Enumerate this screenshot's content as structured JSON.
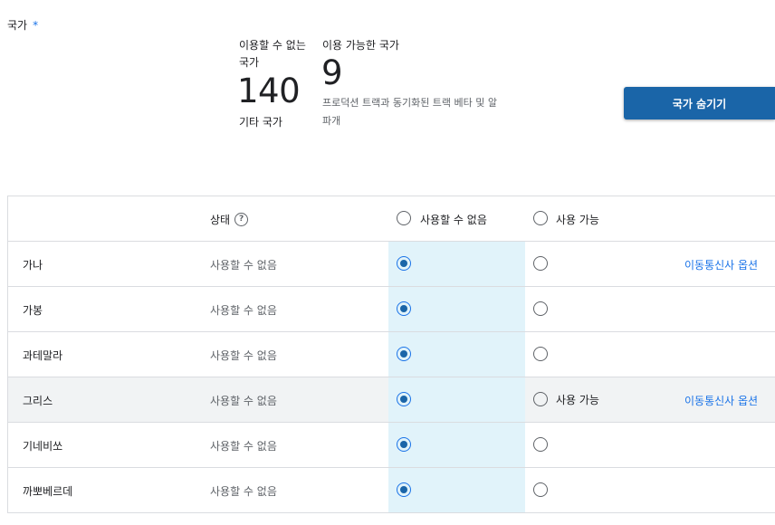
{
  "field": {
    "label": "국가",
    "required_mark": "*"
  },
  "stats": {
    "unavailable": {
      "label": "이용할 수 없는 국가",
      "count": "140",
      "sub": "기타 국가"
    },
    "available": {
      "label": "이용 가능한 국가",
      "count": "9",
      "sub": "프로덕션 트랙과 동기화된 트랙 베타 및 알파개"
    }
  },
  "hide_button": {
    "label": "국가 숨기기"
  },
  "table": {
    "header": {
      "status": "상태",
      "help_icon": "?",
      "option_unavailable": "사용할 수 없음",
      "option_available": "사용 가능"
    },
    "rows": [
      {
        "name": "가나",
        "status": "사용할 수 없음",
        "link": "이동통신사 옵션"
      },
      {
        "name": "가봉",
        "status": "사용할 수 없음"
      },
      {
        "name": "과테말라",
        "status": "사용할 수 없음"
      },
      {
        "name": "그리스",
        "status": "사용할 수 없음",
        "avail_label": "사용 가능",
        "link": "이동통신사 옵션"
      },
      {
        "name": "기네비쏘",
        "status": "사용할 수 없음"
      },
      {
        "name": "까뽀베르데",
        "status": "사용할 수 없음"
      }
    ]
  }
}
